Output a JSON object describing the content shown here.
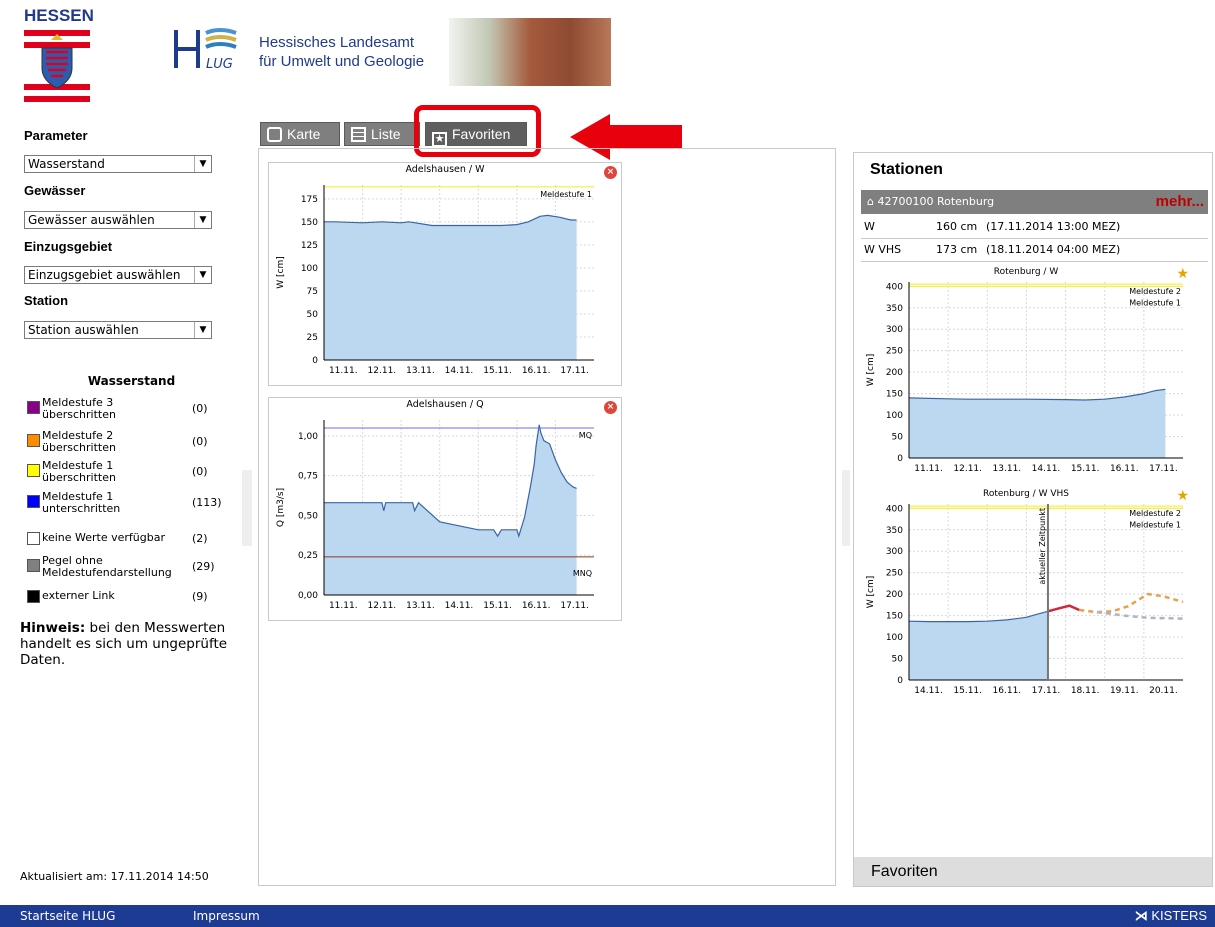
{
  "header": {
    "state_name": "HESSEN",
    "agency_line1": "Hessisches Landesamt",
    "agency_line2": "für Umwelt und Geologie",
    "logo_text": "LUG"
  },
  "sidebar": {
    "parameter_label": "Parameter",
    "parameter_value": "Wasserstand",
    "gewaesser_label": "Gewässer",
    "gewaesser_value": "Gewässer auswählen",
    "einzugsgebiet_label": "Einzugsgebiet",
    "einzugsgebiet_value": "Einzugsgebiet auswählen",
    "station_label": "Station",
    "station_value": "Station auswählen",
    "legend_title": "Wasserstand",
    "legend": [
      {
        "line1": "Meldestufe 3",
        "line2": "überschritten",
        "count": "(0)",
        "color": "#8b008b"
      },
      {
        "line1": "Meldestufe 2",
        "line2": "überschritten",
        "count": "(0)",
        "color": "#ff8c00"
      },
      {
        "line1": "Meldestufe 1",
        "line2": "überschritten",
        "count": "(0)",
        "color": "#ffff00"
      },
      {
        "line1": "Meldestufe 1",
        "line2": "unterschritten",
        "count": "(113)",
        "color": "#0000ff"
      },
      {
        "line1": "keine Werte verfügbar",
        "line2": "",
        "count": "(2)",
        "color": "#ffffff"
      },
      {
        "line1": "Pegel ohne",
        "line2": "Meldestufendarstellung",
        "count": "(29)",
        "color": "#808080"
      },
      {
        "line1": "externer Link",
        "line2": "",
        "count": "(9)",
        "color": "#000000"
      }
    ],
    "hint_bold": "Hinweis:",
    "hint_text": " bei den Messwerten handelt es sich um ungeprüfte Daten.",
    "updated": "Aktualisiert am: 17.11.2014  14:50"
  },
  "tabs": [
    {
      "label": "Karte"
    },
    {
      "label": "Liste"
    },
    {
      "label": "Favoriten"
    }
  ],
  "stations_panel": {
    "title": "Stationen",
    "station_name": "42700100 Rotenburg",
    "more": "mehr...",
    "rows": [
      {
        "param": "W",
        "value": "160 cm",
        "time": "(17.11.2014 13:00 MEZ)"
      },
      {
        "param": "W VHS",
        "value": "173 cm",
        "time": "(18.11.2014 04:00 MEZ)"
      }
    ],
    "favorites_label": "Favoriten"
  },
  "footer": {
    "home_link": "Startseite HLUG",
    "imprint_link": "Impressum",
    "brand": "KISTERS"
  },
  "colors": {
    "area_fill": "#bcd7f0",
    "series_line": "#3a64a8",
    "threshold_yellow": "#f3ee1f",
    "mq_line": "#6b6bff",
    "mnq_line": "#8b3a1c",
    "forecast_orange": "#e8a04c",
    "forecast_red": "#cc2a3c",
    "forecast_gray": "#b0b3c6"
  },
  "chart_data": [
    {
      "type": "area",
      "title": "Adelshausen / W",
      "ylabel": "W [cm]",
      "categories": [
        "11.11.",
        "12.11.",
        "13.11.",
        "14.11.",
        "15.11.",
        "16.11.",
        "17.11."
      ],
      "yticks": [
        0,
        25,
        50,
        75,
        100,
        125,
        150,
        175
      ],
      "ylim": [
        0,
        190
      ],
      "xlim": [
        0,
        7
      ],
      "thresholds": [
        {
          "label": "Meldestufe 1",
          "value": 188
        }
      ],
      "series": [
        {
          "x": [
            0,
            0.3,
            1,
            1.5,
            2,
            2.2,
            2.8,
            3.2,
            4,
            4.6,
            5,
            5.3,
            5.6,
            5.8,
            6.1,
            6.4,
            6.55
          ],
          "y": [
            150,
            150,
            149,
            150,
            149,
            150,
            146,
            146,
            146,
            146,
            147,
            150,
            156,
            157,
            155,
            152,
            152
          ]
        }
      ]
    },
    {
      "type": "area",
      "title": "Adelshausen / Q",
      "ylabel": "Q [m3/s]",
      "categories": [
        "11.11.",
        "12.11.",
        "13.11.",
        "14.11.",
        "15.11.",
        "16.11.",
        "17.11."
      ],
      "yticks": [
        "0,00",
        "0,25",
        "0,50",
        "0,75",
        "1,00"
      ],
      "ylim": [
        0,
        1.1
      ],
      "xlim": [
        0,
        7
      ],
      "thresholds": [
        {
          "label": "MQ",
          "value": 1.05
        },
        {
          "label": "MNQ",
          "value": 0.24
        }
      ],
      "series": [
        {
          "x": [
            0,
            1.5,
            1.55,
            1.6,
            2,
            2.3,
            2.35,
            2.45,
            3,
            4,
            4.4,
            4.5,
            4.6,
            5,
            5.05,
            5.2,
            5.35,
            5.45,
            5.5,
            5.58,
            5.62,
            5.7,
            5.85,
            6,
            6.15,
            6.3,
            6.45,
            6.55
          ],
          "y": [
            0.58,
            0.58,
            0.53,
            0.58,
            0.58,
            0.58,
            0.53,
            0.58,
            0.46,
            0.41,
            0.41,
            0.37,
            0.41,
            0.41,
            0.37,
            0.49,
            0.68,
            0.82,
            0.94,
            1.07,
            1.02,
            0.97,
            0.95,
            0.85,
            0.77,
            0.71,
            0.68,
            0.67
          ]
        }
      ]
    },
    {
      "type": "area",
      "title": "Rotenburg / W",
      "ylabel": "W [cm]",
      "categories": [
        "11.11.",
        "12.11.",
        "13.11.",
        "14.11.",
        "15.11.",
        "16.11.",
        "17.11."
      ],
      "yticks": [
        0,
        50,
        100,
        150,
        200,
        250,
        300,
        350,
        400
      ],
      "ylim": [
        0,
        410
      ],
      "xlim": [
        0,
        7
      ],
      "thresholds": [
        {
          "label": "Meldestufe 2",
          "value": 405
        },
        {
          "label": "Meldestufe 1",
          "value": 400
        }
      ],
      "series": [
        {
          "x": [
            0,
            1,
            1.5,
            2,
            3,
            4,
            4.5,
            5,
            5.5,
            6,
            6.3,
            6.55
          ],
          "y": [
            140,
            138,
            137,
            137,
            137,
            136,
            135,
            137,
            142,
            150,
            157,
            160
          ]
        }
      ]
    },
    {
      "type": "area",
      "title": "Rotenburg / W VHS",
      "ylabel": "W [cm]",
      "categories": [
        "14.11.",
        "15.11.",
        "16.11.",
        "17.11.",
        "18.11.",
        "19.11.",
        "20.11."
      ],
      "yticks": [
        0,
        50,
        100,
        150,
        200,
        250,
        300,
        350,
        400
      ],
      "ylim": [
        0,
        410
      ],
      "xlim": [
        0,
        7
      ],
      "thresholds": [
        {
          "label": "Meldestufe 2",
          "value": 405
        },
        {
          "label": "Meldestufe 1",
          "value": 400
        }
      ],
      "now_label": "aktueller Zeitpunkt",
      "now_x": 3.55,
      "series": [
        {
          "x": [
            0,
            0.5,
            1,
            1.5,
            2,
            2.5,
            3,
            3.3,
            3.55
          ],
          "y": [
            137,
            136,
            136,
            136,
            137,
            140,
            146,
            154,
            160
          ]
        },
        {
          "x": [
            3.55,
            3.8,
            4.1,
            4.35
          ],
          "y": [
            160,
            166,
            173,
            163
          ]
        },
        {
          "x": [
            4.35,
            4.8,
            5.2,
            5.6,
            6.1,
            6.5,
            7
          ],
          "y": [
            163,
            158,
            160,
            172,
            200,
            195,
            182
          ]
        },
        {
          "x": [
            4.8,
            5.5,
            6.1,
            7
          ],
          "y": [
            158,
            150,
            145,
            143
          ]
        }
      ]
    }
  ]
}
